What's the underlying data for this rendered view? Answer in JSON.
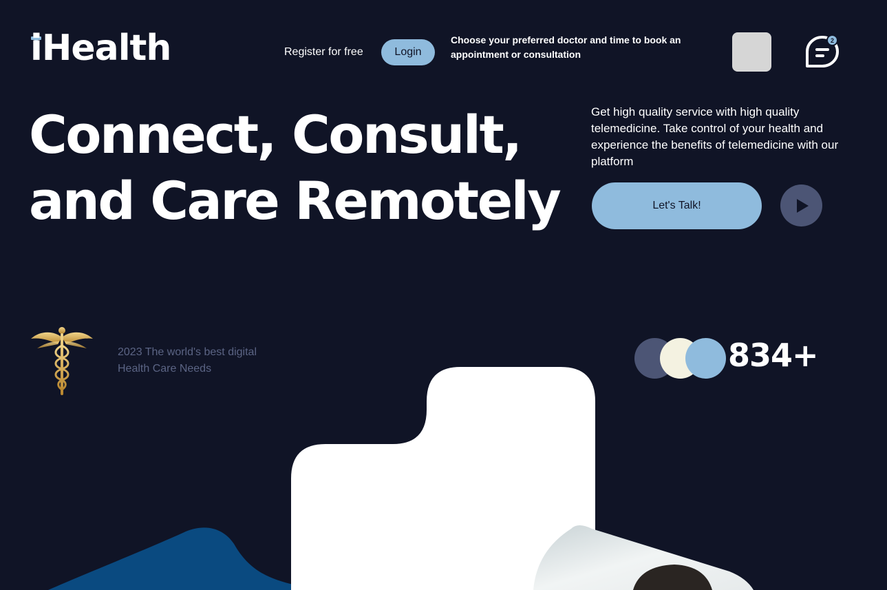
{
  "header": {
    "logo_text": "iHealth",
    "register_label": "Register for free",
    "login_label": "Login",
    "info_text": "Choose your preferred doctor and time to book an appointment or consultation",
    "chat_badge_count": "2"
  },
  "hero": {
    "title": "Connect, Consult, and Care Remotely",
    "description": "Get high quality service with high quality telemedicine. Take control of your health and experience the benefits of telemedicine with our platform",
    "cta_label": "Let's Talk!"
  },
  "stats": {
    "tagline": "2023 The world's best digital Health Care Needs",
    "count": "834+"
  },
  "icons": {
    "logo_plus": "plus-icon",
    "chat": "chat-bubble-icon",
    "play": "play-icon",
    "caduceus": "caduceus-icon"
  },
  "colors": {
    "background": "#101426",
    "accent": "#8fbbdd",
    "muted": "#4c5575",
    "cream": "#f4f2e1",
    "deep_blue": "#0a4a80"
  }
}
